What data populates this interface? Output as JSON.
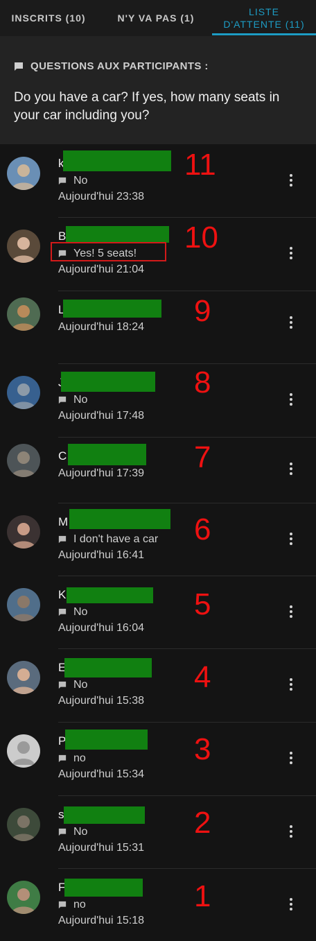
{
  "tabs": [
    {
      "label": "INSCRITS (10)",
      "active": false
    },
    {
      "label": "N'Y VA PAS (1)",
      "active": false
    },
    {
      "label_line1": "LISTE",
      "label_line2": "D'ATTENTE (11)",
      "active": true
    }
  ],
  "questions": {
    "header": "QUESTIONS AUX PARTICIPANTS :",
    "text": "Do you have a car? If yes, how many seats in your car including you?",
    "icon": "comment-icon"
  },
  "colors": {
    "accent": "#1d9cc4",
    "redaction": "#118011",
    "annotation": "#ee1111",
    "background": "#141414"
  },
  "rows": [
    {
      "initial": "k",
      "answer": "No",
      "time": "Aujourd'hui 23:38",
      "number": "11"
    },
    {
      "initial": "B",
      "answer": "Yes! 5 seats!",
      "time": "Aujourd'hui 21:04",
      "number": "10",
      "highlighted": true
    },
    {
      "initial": "L",
      "answer": null,
      "time": "Aujourd'hui 18:24",
      "number": "9"
    },
    {
      "initial": "J",
      "answer": "No",
      "time": "Aujourd'hui 17:48",
      "number": "8"
    },
    {
      "initial": "C",
      "answer": null,
      "time": "Aujourd'hui 17:39",
      "number": "7"
    },
    {
      "initial": "M",
      "answer": "I don't have a car",
      "time": "Aujourd'hui 16:41",
      "number": "6"
    },
    {
      "initial": "K",
      "answer": "No",
      "time": "Aujourd'hui 16:04",
      "number": "5"
    },
    {
      "initial": "E",
      "answer": "No",
      "time": "Aujourd'hui 15:38",
      "number": "4"
    },
    {
      "initial": "P",
      "answer": "no",
      "time": "Aujourd'hui 15:34",
      "number": "3"
    },
    {
      "initial": "s",
      "answer": "No",
      "time": "Aujourd'hui 15:31",
      "number": "2"
    },
    {
      "initial": "F",
      "answer": "no",
      "time": "Aujourd'hui 15:18",
      "number": "1"
    }
  ]
}
